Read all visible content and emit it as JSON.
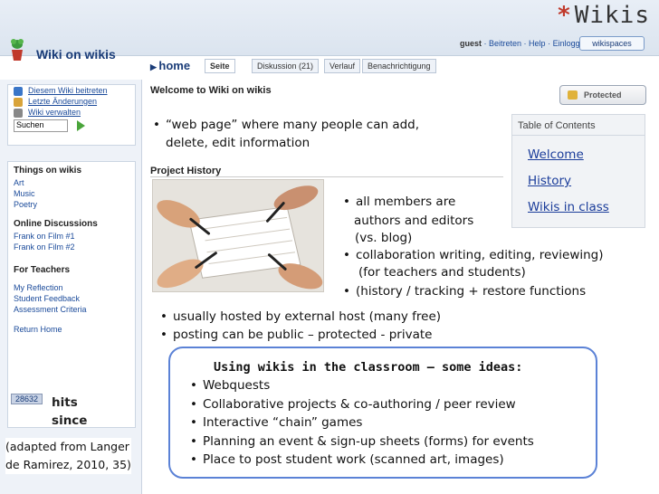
{
  "slide": {
    "title": "Wikis",
    "credit_line1": "(adapted from Langer",
    "credit_line2": "de Ramirez, 2010, 35)"
  },
  "wiki_ui": {
    "site_title": "Wiki on wikis",
    "user": "guest",
    "user_links": [
      "Beitreten",
      "Help",
      "Einloggen"
    ],
    "brand": "wikispaces",
    "home": "home",
    "tabs": [
      "Seite",
      "Diskussion (21)",
      "Verlauf",
      "Benachrichtigung"
    ],
    "page_heading": "Welcome to Wiki on wikis",
    "protected_label": "Protected",
    "section_heading": "Project History",
    "sidebar_links": [
      "Diesem Wiki beitreten",
      "Letzte Änderungen",
      "Wiki verwalten"
    ],
    "search_placeholder": "Suchen",
    "things_heading": "Things on wikis",
    "things": [
      "Art",
      "Music",
      "Poetry"
    ],
    "discussions_heading": "Online Discussions",
    "discussions": [
      "Frank on Film #1",
      "Frank on Film #2"
    ],
    "teachers_heading": "For Teachers",
    "teachers": [
      "My Reflection",
      "Student Feedback",
      "Assessment Criteria"
    ],
    "return_home": "Return Home",
    "hits_count": "28632",
    "hits_label": "hits since"
  },
  "toc": {
    "heading": "Table of Contents",
    "items": [
      "Welcome",
      "History",
      "Wikis in class"
    ]
  },
  "bullets": {
    "intro_line1": "“web page” where many people can add,",
    "intro_line2": "delete, edit information",
    "members_line1": "all members are",
    "members_line2": "authors and editors",
    "members_line3": "(vs. blog)",
    "collab_line1": "collaboration writing, editing, reviewing)",
    "collab_line2": "(for teachers and students)",
    "history": "(history / tracking + restore functions",
    "hosted": "usually hosted by external host (many free)",
    "posting": "posting can be public – protected - private"
  },
  "ideas": {
    "title": "Using wikis in the classroom – some ideas:",
    "items": [
      "Webquests",
      "Collaborative projects & co-authoring / peer review",
      "Interactive “chain” games",
      "Planning an event & sign-up sheets (forms) for events",
      "Place to post student work (scanned art, images)"
    ]
  },
  "colors": {
    "accent_star": "#c0392b",
    "link_blue": "#1a4a9a",
    "box_border": "#5b82d6"
  }
}
